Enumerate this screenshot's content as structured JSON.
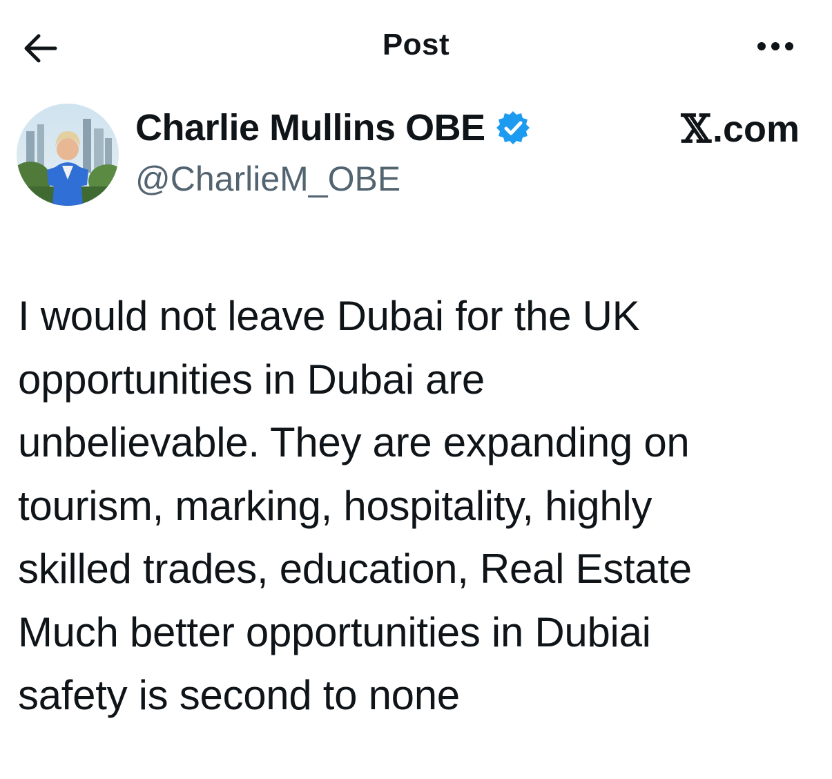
{
  "header": {
    "title": "Post",
    "back_icon": "arrow-left-icon",
    "more_icon": "more-horizontal-icon"
  },
  "author": {
    "display_name": "Charlie Mullins OBE",
    "handle": "@CharlieM_OBE",
    "verified": true,
    "verified_color": "#1d9bf0",
    "source_label": ".com",
    "source_logo": "x-logo-icon"
  },
  "post": {
    "lines": [
      "I would not leave Dubai for the UK",
      "opportunities in Dubai are",
      "unbelievable. They are expanding on",
      "tourism, marking, hospitality, highly",
      "skilled trades, education, Real Estate",
      "Much better opportunities in Dubiai",
      "safety is second to none"
    ]
  },
  "colors": {
    "text_primary": "#0f1419",
    "text_secondary": "#536471",
    "background": "#ffffff"
  }
}
